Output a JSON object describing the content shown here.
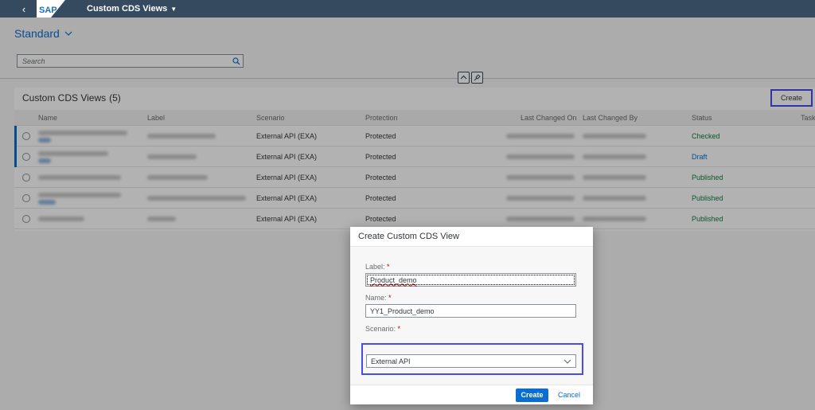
{
  "shell": {
    "app_title": "Custom CDS Views",
    "logo_text": "SAP"
  },
  "variant": {
    "name": "Standard"
  },
  "search": {
    "placeholder": "Search"
  },
  "table": {
    "title": "Custom CDS Views",
    "count": "(5)",
    "create_label": "Create",
    "columns": [
      "Name",
      "Label",
      "Scenario",
      "Protection",
      "Last Changed On",
      "Last Changed By",
      "Status",
      "Task"
    ],
    "rows": [
      {
        "scenario": "External API (EXA)",
        "protection": "Protected",
        "status": "Checked"
      },
      {
        "scenario": "External API (EXA)",
        "protection": "Protected",
        "status": "Draft"
      },
      {
        "scenario": "External API (EXA)",
        "protection": "Protected",
        "status": "Published"
      },
      {
        "scenario": "External API (EXA)",
        "protection": "Protected",
        "status": "Published"
      },
      {
        "scenario": "External API (EXA)",
        "protection": "Protected",
        "status": "Published"
      }
    ]
  },
  "dialog": {
    "title": "Create Custom CDS View",
    "label_field": {
      "label": "Label:",
      "value": "Product_demo"
    },
    "name_field": {
      "label": "Name:",
      "value": "YY1_Product_demo"
    },
    "scenario_field": {
      "label": "Scenario:",
      "value": "External API"
    },
    "required_mark": "*",
    "create_label": "Create",
    "cancel_label": "Cancel"
  },
  "colors": {
    "shell": "#354a5f",
    "accent": "#0a6ed1",
    "positive": "#107e3e",
    "highlight": "#4a4af0"
  }
}
